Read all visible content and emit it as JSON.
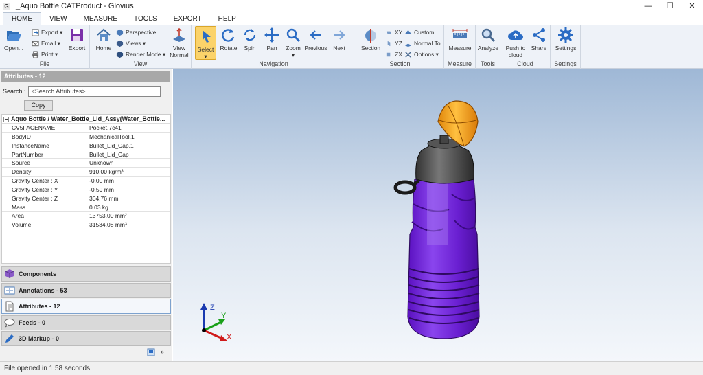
{
  "window": {
    "app_icon": "G",
    "title": "_Aquo Bottle.CATProduct - Glovius",
    "controls": [
      "—",
      "❐",
      "✕"
    ]
  },
  "ribbon_tabs": [
    "HOME",
    "VIEW",
    "MEASURE",
    "TOOLS",
    "EXPORT",
    "HELP"
  ],
  "ribbon": {
    "file": {
      "label": "File",
      "open": "Open...",
      "export_small": "Export",
      "email": "Email",
      "print": "Print",
      "export_big": "Export"
    },
    "view": {
      "label": "View",
      "home": "Home",
      "perspective": "Perspective",
      "views": "Views",
      "render_mode": "Render Mode",
      "view_normal_1": "View",
      "view_normal_2": "Normal"
    },
    "navigation": {
      "label": "Navigation",
      "select": "Select",
      "rotate": "Rotate",
      "spin": "Spin",
      "pan": "Pan",
      "zoom": "Zoom",
      "previous": "Previous",
      "next": "Next"
    },
    "section": {
      "label": "Section",
      "section": "Section",
      "xy": "XY",
      "yz": "YZ",
      "zx": "ZX",
      "custom": "Custom",
      "normal_to": "Normal To",
      "options": "Options"
    },
    "measure": {
      "label": "Measure",
      "measure": "Measure"
    },
    "tools": {
      "label": "Tools",
      "analyze": "Analyze"
    },
    "cloud": {
      "label": "Cloud",
      "push_1": "Push to",
      "push_2": "cloud",
      "share": "Share"
    },
    "settings": {
      "label": "Settings",
      "settings": "Settings"
    }
  },
  "attributes_panel": {
    "header": "Attributes - 12",
    "search_label": "Search :",
    "search_placeholder": "<Search Attributes>",
    "copy_label": "Copy",
    "tree_title": "Aquo Bottle / Water_Bottle_Lid_Assy(Water_Bottle...",
    "rows": [
      {
        "key": "CV5FACENAME",
        "value": "Pocket.7c41"
      },
      {
        "key": "BodyID",
        "value": "MechanicalTool.1"
      },
      {
        "key": "InstanceName",
        "value": "Bullet_Lid_Cap.1"
      },
      {
        "key": "PartNumber",
        "value": "Bullet_Lid_Cap"
      },
      {
        "key": "Source",
        "value": "Unknown"
      },
      {
        "key": "Density",
        "value": "910.00 kg/m³"
      },
      {
        "key": "Gravity Center : X",
        "value": "-0.00 mm"
      },
      {
        "key": "Gravity Center : Y",
        "value": "-0.59 mm"
      },
      {
        "key": "Gravity Center : Z",
        "value": "304.76 mm"
      },
      {
        "key": "Mass",
        "value": "0.03 kg"
      },
      {
        "key": "Area",
        "value": "13753.00 mm²"
      },
      {
        "key": "Volume",
        "value": "31534.08 mm³"
      }
    ]
  },
  "section_tabs": [
    {
      "label": "Components",
      "icon": "cube-icon"
    },
    {
      "label": "Annotations - 53",
      "icon": "annotation-icon"
    },
    {
      "label": "Attributes - 12",
      "icon": "document-icon"
    },
    {
      "label": "Feeds - 0",
      "icon": "chat-icon"
    },
    {
      "label": "3D Markup - 0",
      "icon": "pen-icon"
    }
  ],
  "panel_footer": {
    "expand": "»"
  },
  "axes": {
    "x": "X",
    "y": "Y",
    "z": "Z"
  },
  "colors": {
    "bottle": "#6a1fd1",
    "cap": "#f5a21c",
    "accent": "#2b6cc4"
  },
  "status": "File opened in 1.58 seconds"
}
